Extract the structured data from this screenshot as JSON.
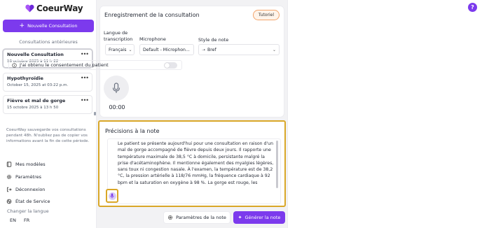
{
  "app": {
    "name": "CoeurWay",
    "brand_color": "#7c3aed",
    "highlight_color": "#d9a728"
  },
  "sidebar": {
    "new_consultation_label": "Nouvelle Consultation",
    "previous_title": "Consultations antérieures",
    "consultations": [
      {
        "name": "Nouvelle Consultation",
        "date": "16 octobre 2025 à 11 h 22",
        "active": true
      },
      {
        "name": "Hypothyroïdie",
        "date": "October 15, 2025 at 03:22 p.m.",
        "active": false
      },
      {
        "name": "Fièvre et mal de gorge",
        "date": "15 octobre 2025 à 13 h 50",
        "active": false
      }
    ],
    "notice": "CoeurWay sauvegarde vos consultations pendant 48h. N'oubliez pas de copier vos informations avant la fin de cette période.",
    "menu": [
      {
        "label": "Mes modèles",
        "icon": "book-icon"
      },
      {
        "label": "Paramètres",
        "icon": "gear-icon"
      },
      {
        "label": "Déconnexion",
        "icon": "logout-icon"
      },
      {
        "label": "État de Service",
        "icon": "status-icon"
      }
    ],
    "language_label": "Changer la langue",
    "languages": [
      "EN",
      "FR"
    ]
  },
  "recording": {
    "title": "Enregistrement de la consultation",
    "tutorial_label": "Tutoriel",
    "language_label": "Langue de transcription",
    "language_value": "Français",
    "microphone_label": "Microphone",
    "microphone_value": "Default - Microphon...",
    "style_label": "Style de note",
    "style_value": "Bref",
    "consent_label": "J'ai obtenu le consentement du patient",
    "consent_checked": false,
    "timer": "00:00"
  },
  "notes": {
    "title": "Précisions à la note",
    "text": "Le patient se présente aujourd'hui pour une consultation en raison d'un mal de gorge accompagné de fièvre depuis deux jours. Il rapporte une température maximale de 38,5 °C à domicile, persistante malgré la prise d'acétaminophène. Il mentionne également des myalgies légères, sans toux ni congestion nasale. À l'examen, la température est de 38,2 °C, la pression artérielle à 118/76 mmHg, la fréquence cardiaque à 92 bpm et la saturation en oxygène à 98 %. La gorge est rouge, les amygdales sont hypertrophiées et recouvertes de points blanchâtres."
  },
  "footer": {
    "params_label": "Paramètres de la note",
    "generate_label": "Générer la note"
  },
  "help_label": "?"
}
